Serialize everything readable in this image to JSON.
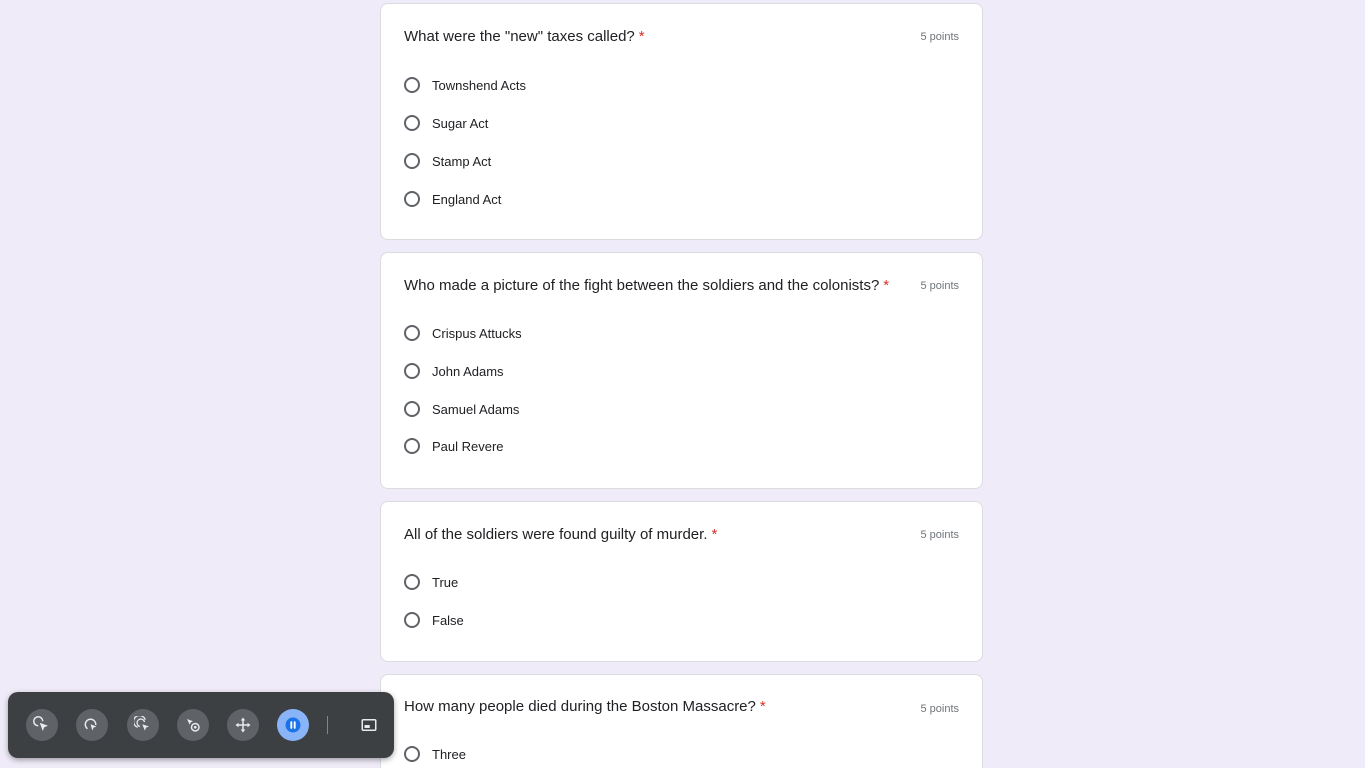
{
  "form": {
    "required_marker": "*",
    "questions": [
      {
        "title": "What were the \"new\" taxes called?",
        "points": "5 points",
        "options": [
          "Townshend Acts",
          "Sugar Act",
          "Stamp Act",
          "England Act"
        ]
      },
      {
        "title": "Who made a picture of the fight between the soldiers and the colonists?",
        "points": "5 points",
        "options": [
          "Crispus Attucks",
          "John Adams",
          "Samuel Adams",
          "Paul Revere"
        ]
      },
      {
        "title": "All of the soldiers were found guilty of murder.",
        "points": "5 points",
        "options": [
          "True",
          "False"
        ]
      },
      {
        "title": "How many people died during the Boston Massacre?",
        "points": "5 points",
        "options": [
          "Three"
        ]
      }
    ]
  },
  "toolbar": {
    "buttons": [
      {
        "icon": "cursor-click-icon"
      },
      {
        "icon": "cursor-loop-icon"
      },
      {
        "icon": "cursor-double-click-icon"
      },
      {
        "icon": "cursor-target-icon"
      },
      {
        "icon": "move-arrows-icon"
      },
      {
        "icon": "pause-icon",
        "active": true
      },
      {
        "icon": "picture-in-picture-icon"
      }
    ]
  },
  "colors": {
    "page_background": "#f0ebf8",
    "required": "#d93025",
    "toolbar_background": "#3c4043",
    "toolbar_active": "#8ab4f8"
  }
}
